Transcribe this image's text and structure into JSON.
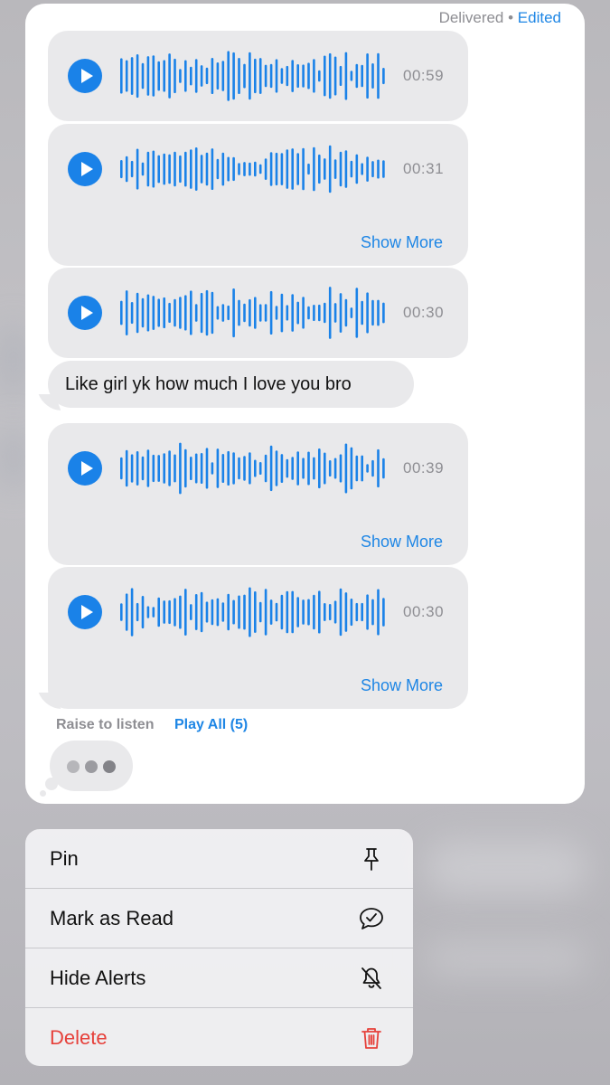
{
  "status": {
    "delivered": "Delivered",
    "separator": " • ",
    "edited": "Edited"
  },
  "audio_messages": [
    {
      "duration": "00:59",
      "show_more": ""
    },
    {
      "duration": "00:31",
      "show_more": "Show More"
    },
    {
      "duration": "00:30",
      "show_more": ""
    },
    {
      "duration": "00:39",
      "show_more": "Show More"
    },
    {
      "duration": "00:30",
      "show_more": "Show More"
    }
  ],
  "text_message": "Like girl yk how much I love you bro",
  "footer": {
    "raise_to_listen": "Raise to listen",
    "play_all": "Play All (5)"
  },
  "menu": [
    {
      "label": "Pin",
      "icon": "pin-icon"
    },
    {
      "label": "Mark as Read",
      "icon": "chat-check-icon"
    },
    {
      "label": "Hide Alerts",
      "icon": "bell-slash-icon"
    },
    {
      "label": "Delete",
      "icon": "trash-icon"
    }
  ],
  "colors": {
    "accent": "#1a82e8",
    "bubble": "#e9e9eb",
    "danger": "#e6403a",
    "typing_dot": "#9b9ba0"
  }
}
